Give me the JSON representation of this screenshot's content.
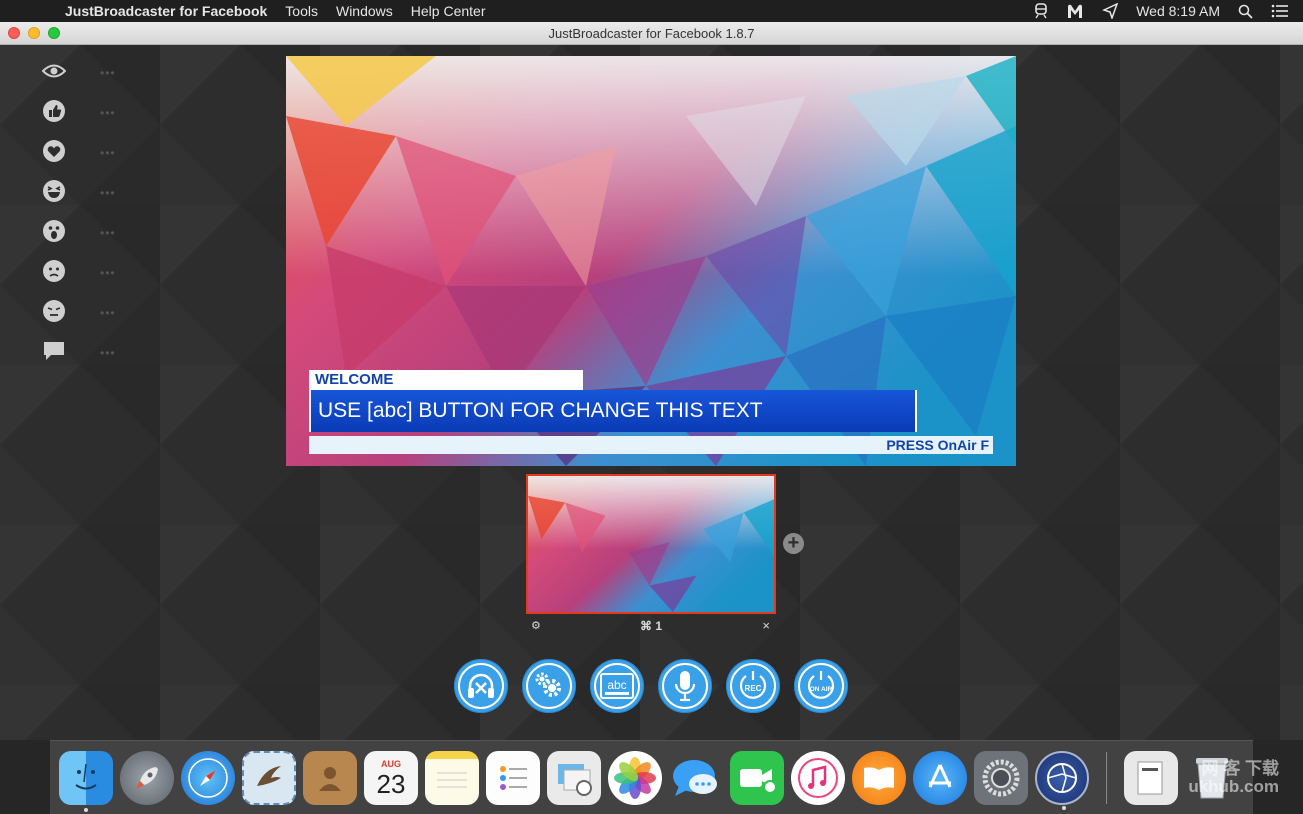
{
  "menubar": {
    "app_name": "JustBroadcaster for Facebook",
    "items": [
      "Tools",
      "Windows",
      "Help Center"
    ],
    "clock": "Wed 8:19 AM"
  },
  "window": {
    "title": "JustBroadcaster for Facebook 1.8.7"
  },
  "reactions": [
    {
      "icon": "eye-icon",
      "count": "•••"
    },
    {
      "icon": "like-icon",
      "count": "•••"
    },
    {
      "icon": "love-icon",
      "count": "•••"
    },
    {
      "icon": "haha-icon",
      "count": "•••"
    },
    {
      "icon": "wow-icon",
      "count": "•••"
    },
    {
      "icon": "sad-icon",
      "count": "•••"
    },
    {
      "icon": "angry-icon",
      "count": "•••"
    },
    {
      "icon": "comment-icon",
      "count": "•••"
    }
  ],
  "preview": {
    "lower_third_label": "WELCOME",
    "headline": "USE [abc] BUTTON FOR CHANGE THIS TEXT",
    "ticker": "PRESS OnAir F"
  },
  "scene": {
    "shortcut": "⌘ 1",
    "settings_glyph": "⚙",
    "close_glyph": "×",
    "add_glyph": "+"
  },
  "controls": [
    {
      "name": "audio-mute-button",
      "icon": "headphones-x-icon"
    },
    {
      "name": "settings-button",
      "icon": "gears-icon"
    },
    {
      "name": "text-overlay-button",
      "icon": "abc-icon",
      "text": "abc"
    },
    {
      "name": "microphone-button",
      "icon": "microphone-icon"
    },
    {
      "name": "record-button",
      "icon": "rec-power-icon",
      "text": "REC"
    },
    {
      "name": "on-air-button",
      "icon": "on-air-power-icon",
      "text": "ON AIR"
    }
  ],
  "dock": {
    "apps": [
      "Finder",
      "Launchpad",
      "Safari",
      "Mail",
      "Contacts",
      "Calendar",
      "Notes",
      "Reminders",
      "Preview",
      "Photos",
      "Messages",
      "FaceTime",
      "iTunes",
      "iBooks",
      "App Store",
      "System Preferences",
      "JustBroadcaster"
    ],
    "calendar_month": "AUG",
    "calendar_day": "23"
  },
  "watermark": {
    "line1": "网 客 下载",
    "line2": "ukhub.com"
  },
  "colors": {
    "accent": "#3aa0e8",
    "selection": "#e23a1d",
    "headline_bg": "#0a3ab5"
  }
}
